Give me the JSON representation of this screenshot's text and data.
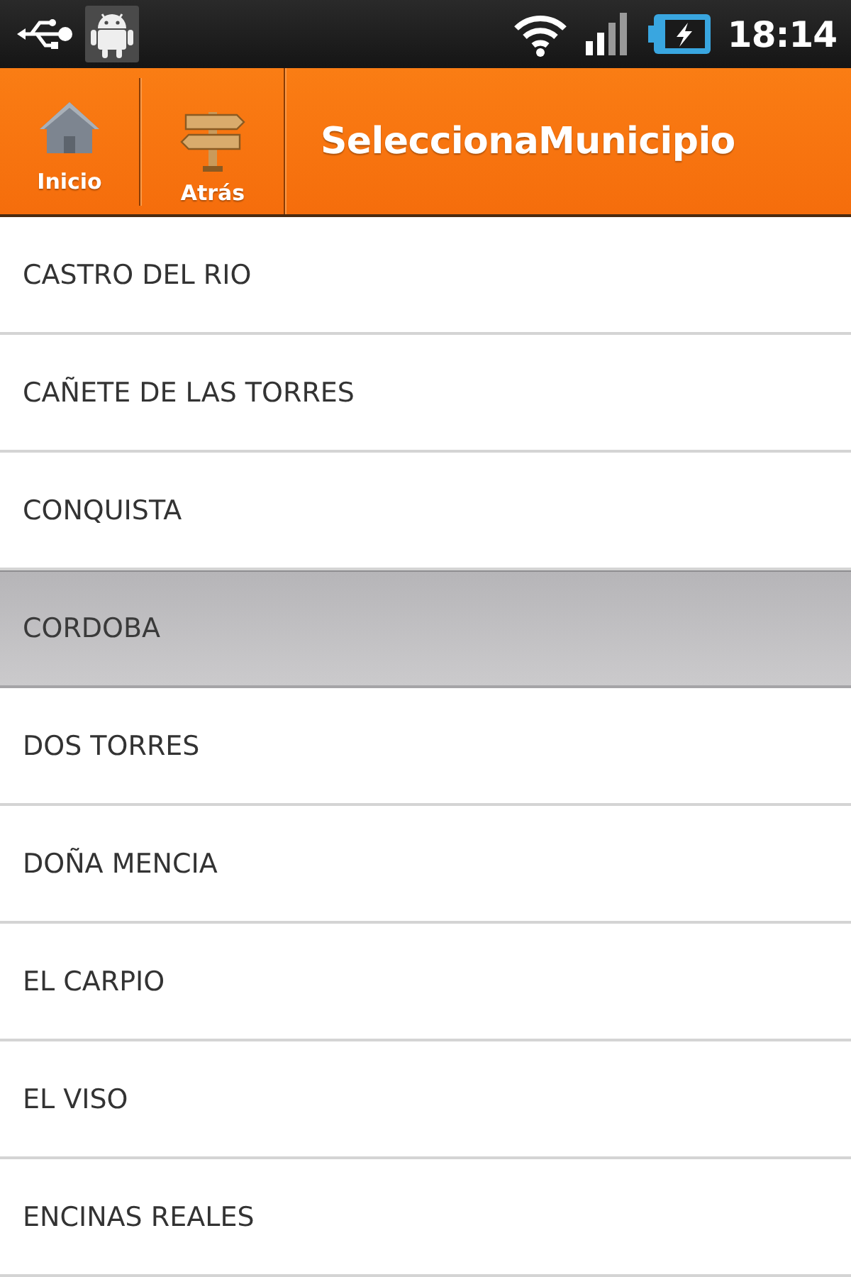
{
  "status_bar": {
    "time": "18:14"
  },
  "header": {
    "buttons": [
      {
        "kind": "home",
        "label": "Inicio"
      },
      {
        "kind": "signpost",
        "label": "Atrás"
      }
    ],
    "title": "SeleccionaMunicipio"
  },
  "list": {
    "items": [
      {
        "label": "CASTRO DEL RIO",
        "selected": false
      },
      {
        "label": "CAÑETE DE LAS TORRES",
        "selected": false
      },
      {
        "label": "CONQUISTA",
        "selected": false
      },
      {
        "label": "CORDOBA",
        "selected": true
      },
      {
        "label": "DOS TORRES",
        "selected": false
      },
      {
        "label": "DOÑA MENCIA",
        "selected": false
      },
      {
        "label": "EL CARPIO",
        "selected": false
      },
      {
        "label": "EL VISO",
        "selected": false
      },
      {
        "label": "ENCINAS REALES",
        "selected": false
      }
    ]
  }
}
